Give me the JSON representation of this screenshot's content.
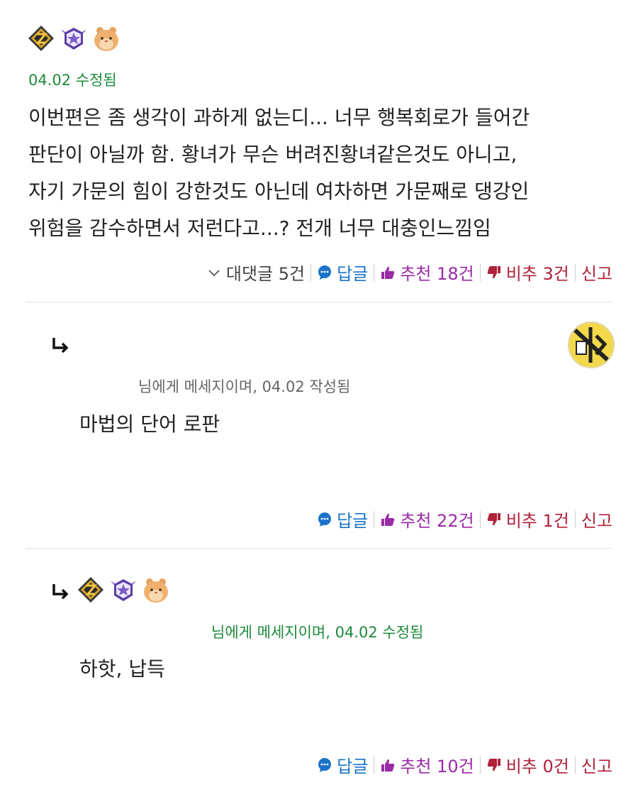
{
  "comments": [
    {
      "timestamp": "04.02 수정됨",
      "content_lines": [
        "이번편은 좀 생각이 과하게 없는디... 너무 행복회로가 들어간",
        "판단이 아닐까 함. 황녀가 무슨 버려진황녀같은것도 아니고,",
        "자기 가문의 힘이 강한것도 아닌데 여차하면 가문째로 댕강인",
        "위험을 감수하면서 저런다고...? 전개 너무 대충인느낌임"
      ],
      "actions": {
        "replies": "대댓글 5건",
        "reply": "답글",
        "upvote": "추천 18건",
        "downvote": "비추 3건",
        "report": "신고"
      }
    },
    {
      "meta": "님에게 메세지이며, 04.02 작성됨",
      "content": "마법의 단어 로판",
      "actions": {
        "reply": "답글",
        "upvote": "추천 22건",
        "downvote": "비추 1건",
        "report": "신고"
      }
    },
    {
      "meta": "님에게 메세지이며, 04.02 수정됨",
      "content": "하핫, 납득",
      "actions": {
        "reply": "답글",
        "upvote": "추천 10건",
        "downvote": "비추 0건",
        "report": "신고"
      }
    }
  ],
  "icons": {
    "rank_badge": "gold-rank-emblem-icon",
    "tier_badge": "purple-star-wing-icon",
    "character_badge": "hamster-icon",
    "reply_arrow": "reply-arrow-icon",
    "chevron": "chevron-down-icon",
    "speech_bubble": "speech-bubble-icon",
    "thumbs_up": "thumbs-up-icon",
    "thumbs_down": "thumbs-down-icon"
  },
  "colors": {
    "meta_green": "#1e8a3a",
    "reply_blue": "#1a73c9",
    "upvote_purple": "#9b2aa8",
    "downvote_red": "#b0213a"
  }
}
